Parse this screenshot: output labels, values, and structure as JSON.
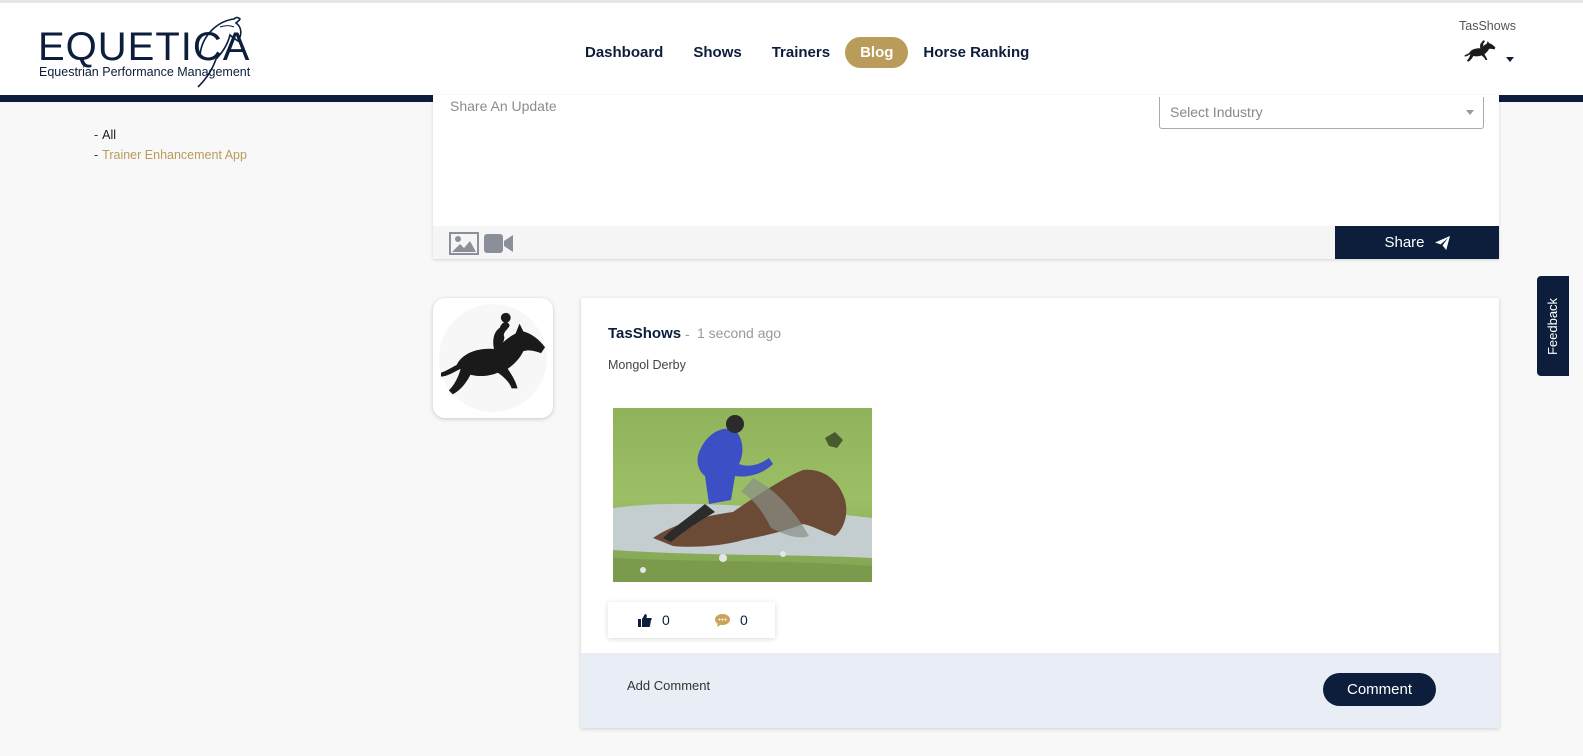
{
  "brand": {
    "name": "EQUETICA",
    "tagline": "Equestrian Performance Management"
  },
  "nav": {
    "items": [
      {
        "label": "Dashboard"
      },
      {
        "label": "Shows"
      },
      {
        "label": "Trainers"
      },
      {
        "label": "Blog",
        "active": true
      },
      {
        "label": "Horse Ranking"
      }
    ]
  },
  "user": {
    "name": "TasShows",
    "avatar_icon": "horse-jumper-icon"
  },
  "categories": {
    "items": [
      {
        "label": "All"
      },
      {
        "label": "Trainer Enhancement App"
      }
    ]
  },
  "composer": {
    "placeholder": "Share An Update",
    "industry_placeholder": "Select Industry",
    "share_label": "Share",
    "icons": [
      "image-icon",
      "video-icon",
      "paper-plane-icon"
    ]
  },
  "post": {
    "author": "TasShows",
    "separator": "-",
    "time": "1 second ago",
    "body": "Mongol Derby",
    "likes": "0",
    "comments": "0",
    "add_comment_placeholder": "Add Comment",
    "comment_label": "Comment"
  },
  "feedback": {
    "label": "Feedback"
  },
  "colors": {
    "navy": "#0c1e3c",
    "gold": "#b99b5a",
    "background": "#f8f8f8",
    "comment_bar": "#e9edf5"
  }
}
